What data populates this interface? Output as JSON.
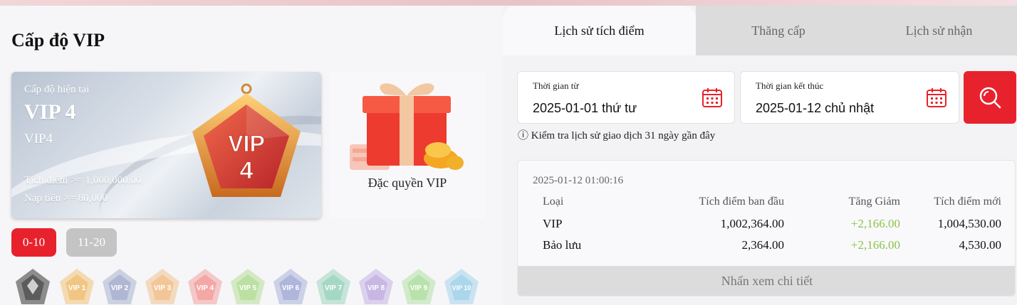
{
  "page": {
    "title": "Cấp độ VIP"
  },
  "vip_card": {
    "label": "Cấp độ hiện tại",
    "level": "VIP 4",
    "sub_level": "VIP4",
    "points_req": "Tích điểm >= 1,000,000.00",
    "deposit_req": "Nạp tiền >= 80,000",
    "badge_text": "VIP",
    "badge_number": "4"
  },
  "privilege": {
    "label": "Đặc quyền VIP"
  },
  "ranges": [
    {
      "label": "0-10",
      "active": true
    },
    {
      "label": "11-20",
      "active": false
    }
  ],
  "level_badges": [
    {
      "text": "",
      "color": "#9a9a9a"
    },
    {
      "text": "VIP 1",
      "color": "#f0c27a"
    },
    {
      "text": "VIP 2",
      "color": "#a9b3cf"
    },
    {
      "text": "VIP 3",
      "color": "#f1c28f"
    },
    {
      "text": "VIP 4",
      "color": "#f2a2a0"
    },
    {
      "text": "VIP 5",
      "color": "#b6de9a"
    },
    {
      "text": "VIP 6",
      "color": "#a9b2d8"
    },
    {
      "text": "VIP 7",
      "color": "#9fd6c0"
    },
    {
      "text": "VIP 8",
      "color": "#c4b2e2"
    },
    {
      "text": "VIP 9",
      "color": "#b4e0a6"
    },
    {
      "text": "VIP 10",
      "color": "#a6d4ea"
    }
  ],
  "tabs": [
    {
      "label": "Lịch sử tích điểm",
      "active": true
    },
    {
      "label": "Thăng cấp",
      "active": false
    },
    {
      "label": "Lịch sử nhận",
      "active": false
    }
  ],
  "filters": {
    "from_label": "Thời gian từ",
    "from_value": "2025-01-01 thứ tư",
    "to_label": "Thời gian kết thúc",
    "to_value": "2025-01-12 chủ nhật",
    "hint": "ⓘ Kiểm tra lịch sử giao dịch 31 ngày gần đây"
  },
  "record": {
    "timestamp": "2025-01-12 01:00:16",
    "columns": [
      "Loại",
      "Tích điểm ban đầu",
      "Tăng Giảm",
      "Tích điểm mới"
    ],
    "rows": [
      [
        "VIP",
        "1,002,364.00",
        "+2,166.00",
        "1,004,530.00"
      ],
      [
        "Bảo lưu",
        "2,364.00",
        "+2,166.00",
        "4,530.00"
      ]
    ],
    "detail_label": "Nhấn xem chi tiết"
  },
  "colors": {
    "accent": "#e8222d",
    "positive": "#8bc34a",
    "inactive": "#c4c4c4"
  }
}
